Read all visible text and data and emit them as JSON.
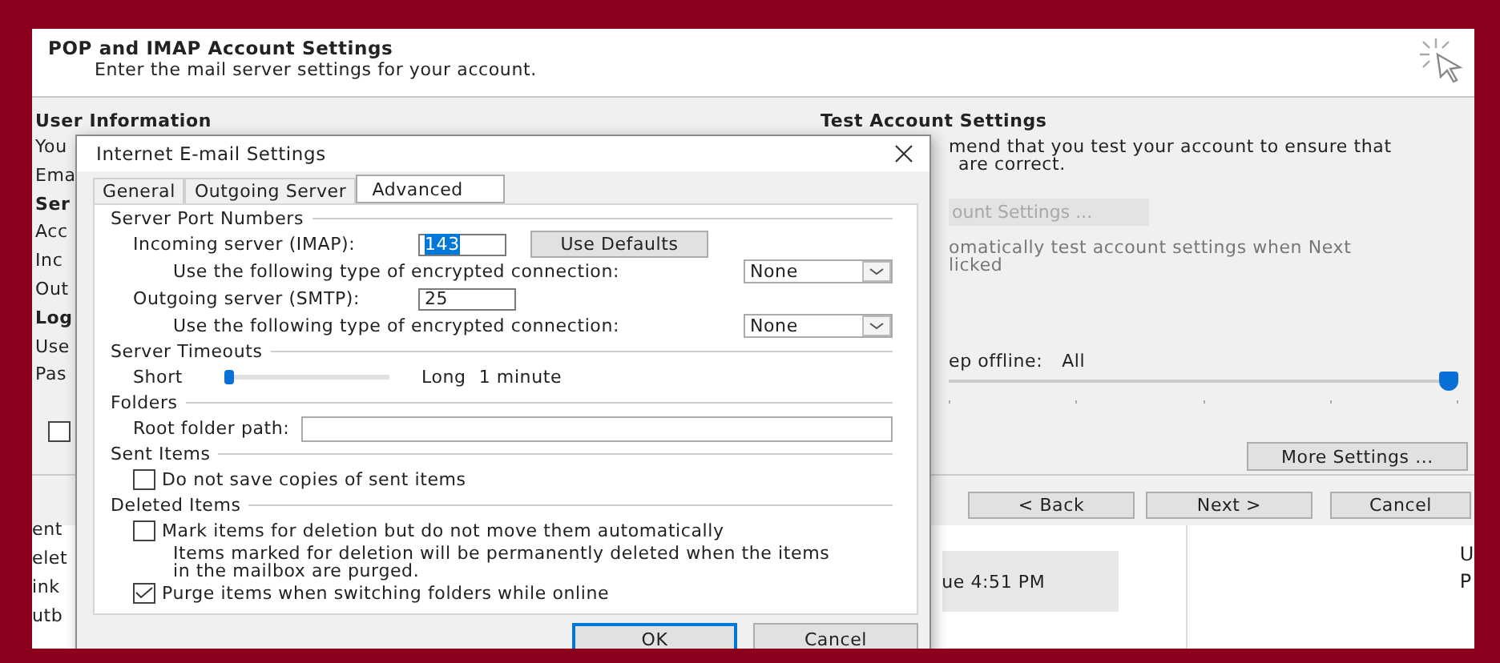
{
  "wizard": {
    "title": "POP and IMAP Account Settings",
    "subtitle": "Enter the mail server settings for your account.",
    "user_heading": "User Information",
    "left_labels": [
      {
        "text": "You",
        "bold": false
      },
      {
        "text": "Ema",
        "bold": false
      },
      {
        "text": "Ser",
        "bold": true
      },
      {
        "text": "Acc",
        "bold": false
      },
      {
        "text": "Inc",
        "bold": false
      },
      {
        "text": "Out",
        "bold": false
      },
      {
        "text": "Log",
        "bold": true
      },
      {
        "text": "Use",
        "bold": false
      },
      {
        "text": "Pas",
        "bold": false
      }
    ],
    "remember_checkbox": {
      "checked": false
    },
    "test_heading": "Test Account Settings",
    "test_lines": [
      "mend that you test your account to ensure that",
      "are correct."
    ],
    "test_button": {
      "label": "ount Settings ...",
      "disabled": true
    },
    "auto_test_lines": [
      "omatically test account settings when Next",
      "licked"
    ],
    "offline_label": "ep offline:",
    "offline_value": "All",
    "offline_slider": {
      "level": 1
    },
    "more_settings_button": "More Settings ...",
    "nav_buttons": [
      "< Back",
      "Next >",
      "Cancel"
    ]
  },
  "background_app": {
    "left_stubs": [
      "ent",
      "elet",
      "ink",
      "utb"
    ],
    "time": "ue 4:51 PM",
    "right_stubs": [
      "U",
      "P"
    ]
  },
  "dialog": {
    "title": "Internet E-mail Settings",
    "tabs": [
      {
        "label": "General",
        "selected": false
      },
      {
        "label": "Outgoing Server",
        "selected": false
      },
      {
        "label": "Advanced",
        "selected": true
      }
    ],
    "sections": [
      {
        "heading": "Server Port Numbers",
        "rows": [
          {
            "kind": "port",
            "label": "Incoming server (IMAP):",
            "value": "143",
            "selected": true,
            "button": "Use Defaults"
          },
          {
            "kind": "encryption",
            "label": "Use the following type of encrypted connection:",
            "value": "None"
          },
          {
            "kind": "port",
            "label": "Outgoing server (SMTP):",
            "value": "25",
            "selected": false
          },
          {
            "kind": "encryption",
            "label": "Use the following type of encrypted connection:",
            "value": "None"
          }
        ]
      },
      {
        "heading": "Server Timeouts",
        "rows": [
          {
            "kind": "timeout",
            "min_label": "Short",
            "max_label": "Long",
            "value": "1 minute",
            "level": 0.1
          }
        ]
      },
      {
        "heading": "Folders",
        "rows": [
          {
            "kind": "path",
            "label": "Root folder path:"
          }
        ]
      },
      {
        "heading": "Sent Items",
        "rows": [
          {
            "kind": "checkbox",
            "label": "Do not save copies of sent items",
            "checked": false
          }
        ]
      },
      {
        "heading": "Deleted Items",
        "rows": [
          {
            "kind": "checkbox",
            "label": "Mark items for deletion but do not move them automatically",
            "checked": false
          },
          {
            "kind": "note",
            "text": "Items marked for deletion will be permanently deleted when the items in the mailbox are purged."
          },
          {
            "kind": "checkbox",
            "label": "Purge items when switching folders while online",
            "checked": true
          }
        ]
      }
    ],
    "buttons": [
      "OK",
      "Cancel"
    ]
  }
}
